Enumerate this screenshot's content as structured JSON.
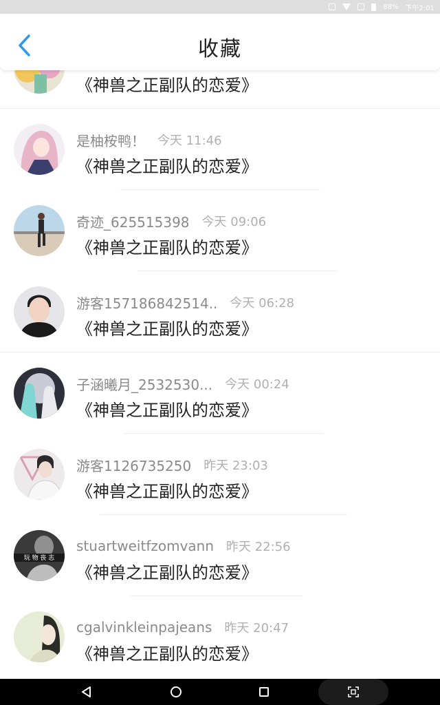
{
  "status_bar": {
    "battery": "88%",
    "time": "下午2:01"
  },
  "header": {
    "title": "收藏",
    "back_icon": "chevron-left-icon"
  },
  "colors": {
    "accent": "#2d9bea",
    "title_text": "#222222",
    "username_text": "#8a8a8a",
    "time_text": "#b0b0b0"
  },
  "items": [
    {
      "username": "",
      "time": "",
      "title": "《神兽之正副队的恋爱》",
      "avatar": "anime-girl-avatar"
    },
    {
      "username": "是柚桉鸭！",
      "time": "今天 11:46",
      "title": "《神兽之正副队的恋爱》",
      "avatar": "pink-hair-girl-avatar"
    },
    {
      "username": "奇迹_625515398",
      "time": "今天 09:06",
      "title": "《神兽之正副队的恋爱》",
      "avatar": "runner-avatar"
    },
    {
      "username": "游客157186842514..",
      "time": "今天 06:28",
      "title": "《神兽之正副队的恋爱》",
      "avatar": "young-man-avatar"
    },
    {
      "username": "子涵曦月_2532530...",
      "time": "今天 00:24",
      "title": "《神兽之正副队的恋爱》",
      "avatar": "anime-duo-avatar"
    },
    {
      "username": "游客1126735250",
      "time": "昨天 23:03",
      "title": "《神兽之正副队的恋爱》",
      "avatar": "boy-triangle-avatar"
    },
    {
      "username": "stuartweitfzomvann",
      "time": "昨天 22:56",
      "title": "《神兽之正副队的恋爱》",
      "avatar": "mono-text-avatar",
      "avatar_text": "玩 物 丧 志"
    },
    {
      "username": "cgalvinkleinpajeans",
      "time": "昨天 20:47",
      "title": "《神兽之正副队的恋爱》",
      "avatar": "woman-portrait-avatar"
    }
  ],
  "nav_bar": {
    "back": "triangle-back-icon",
    "home": "circle-home-icon",
    "recent": "square-recent-icon",
    "extra": "screenshot-icon"
  }
}
